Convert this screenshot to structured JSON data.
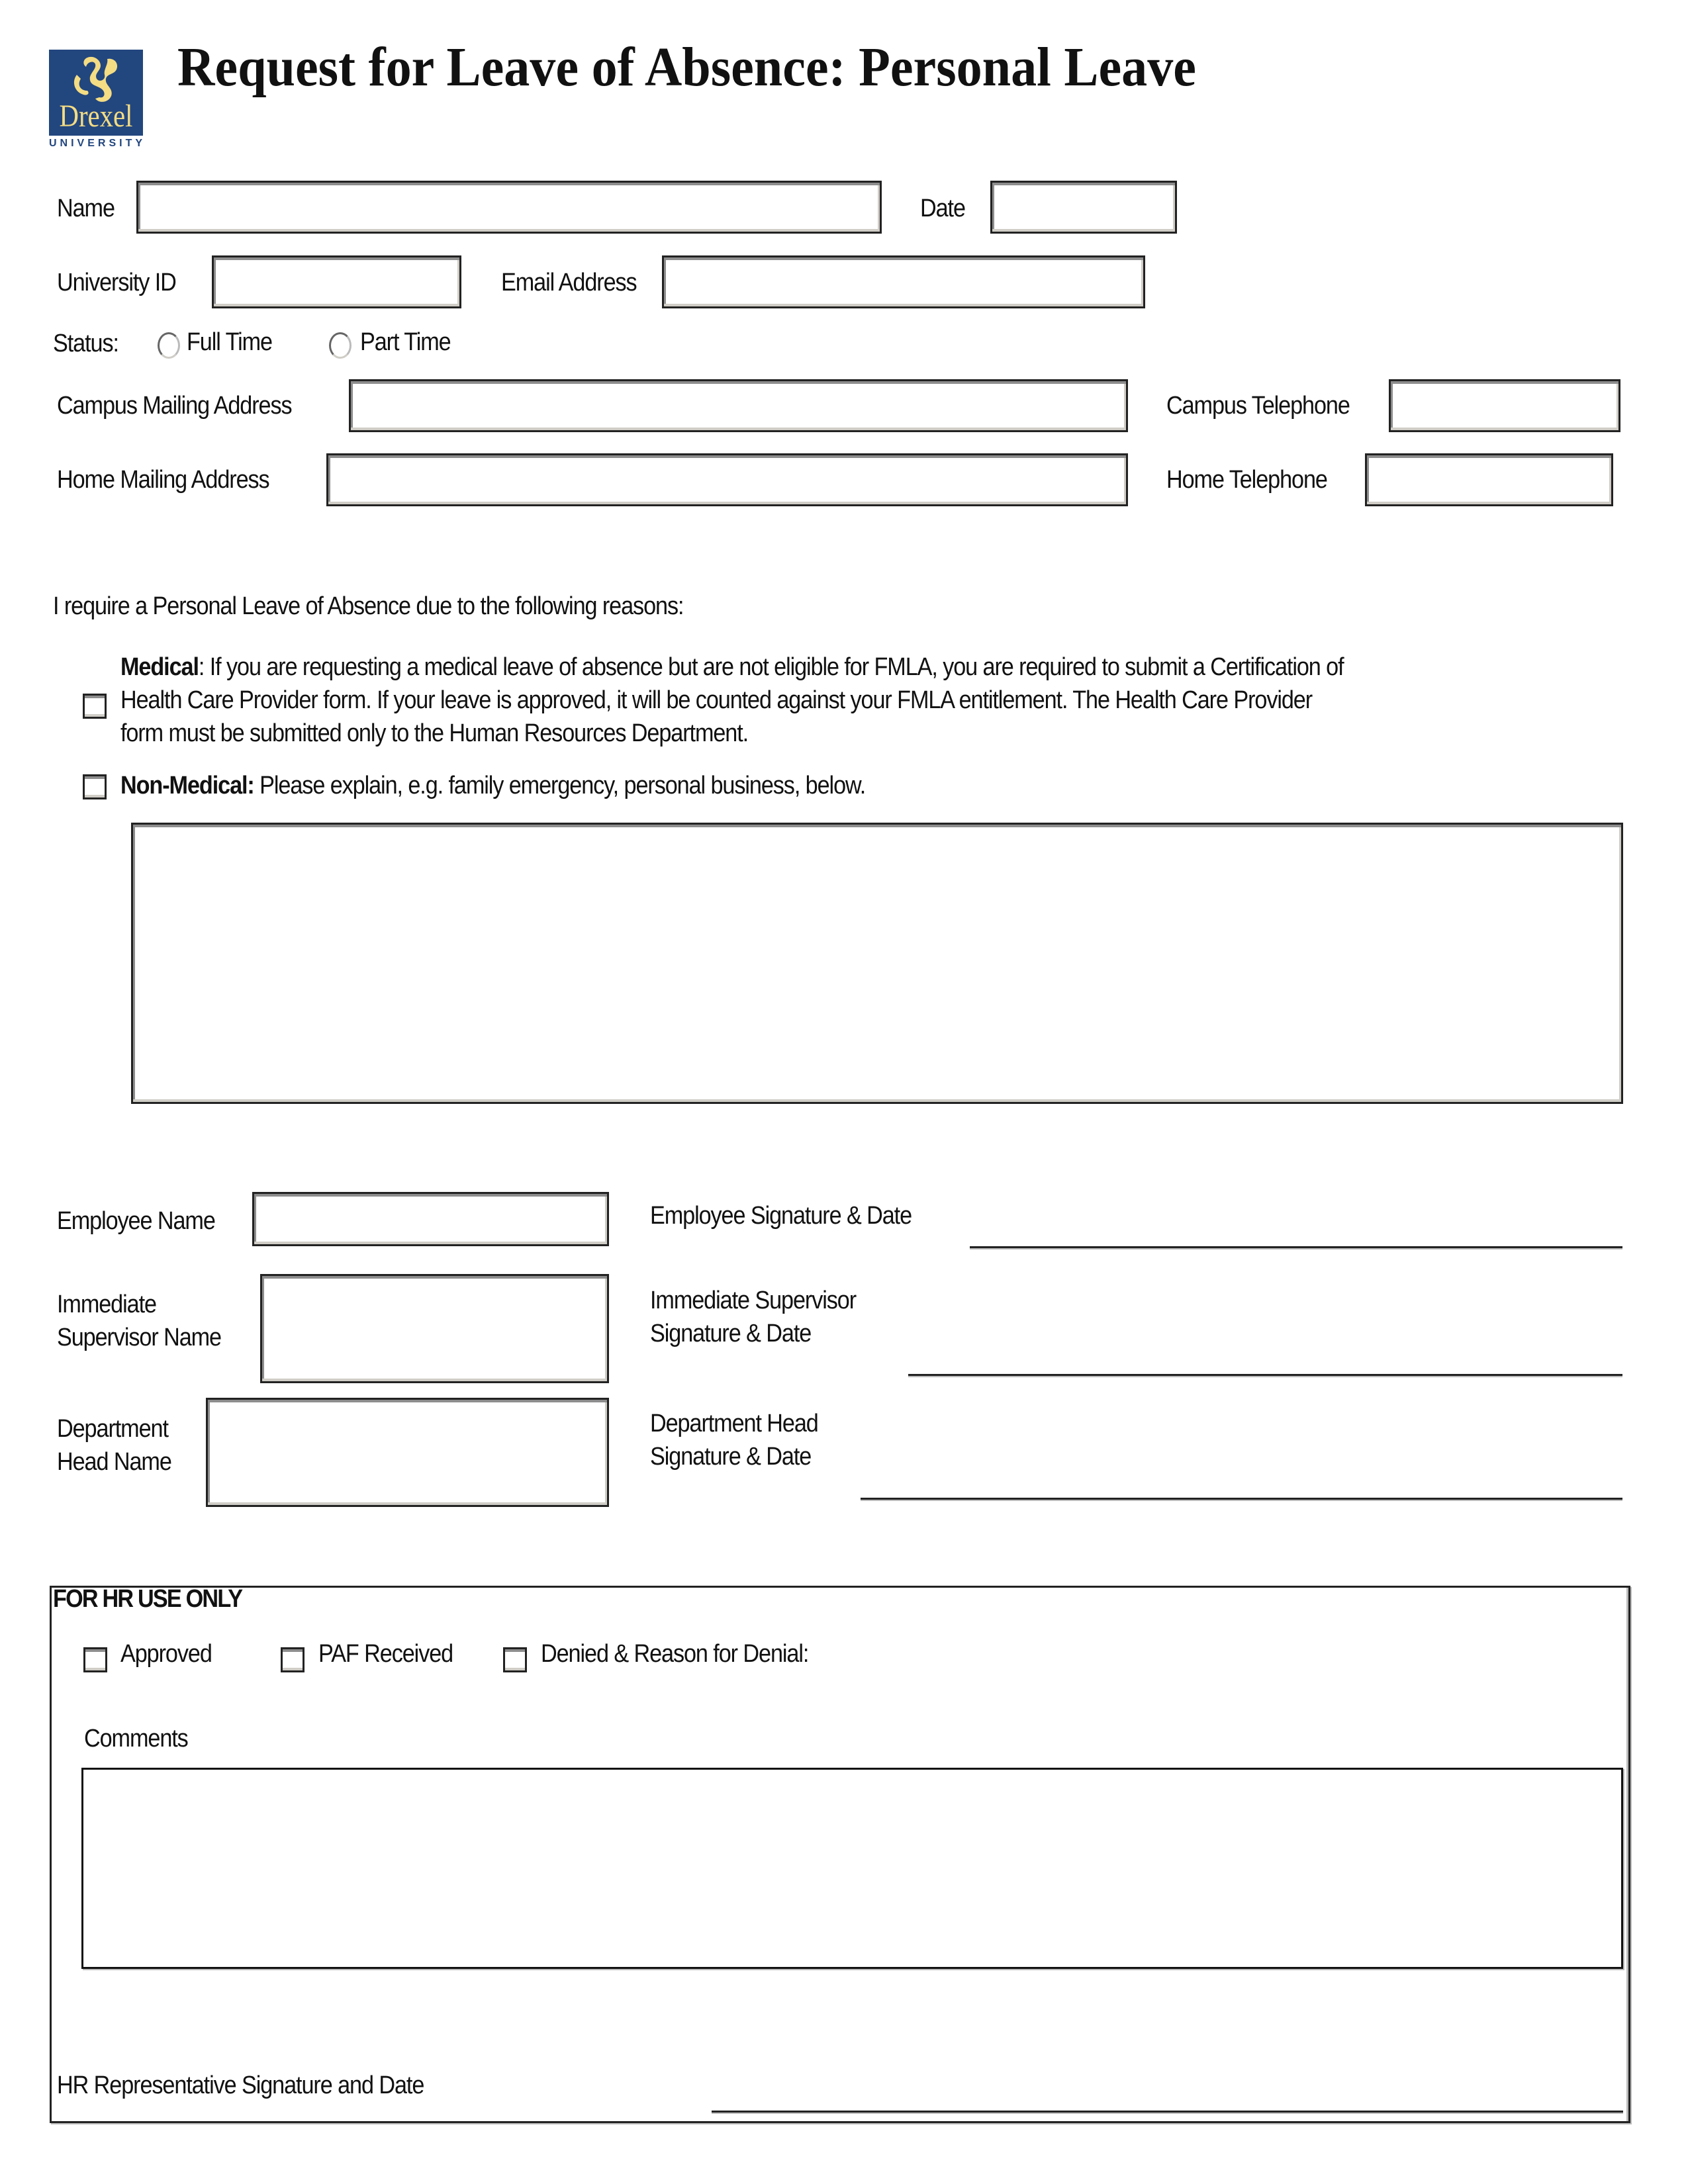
{
  "header": {
    "title": "Request for Leave of Absence: Personal Leave",
    "logo": {
      "name": "drexel-dragon-logo",
      "wordmark": "Drexel",
      "subtitle": "UNIVERSITY",
      "brand_color": "#22467e",
      "accent_color": "#f3dc83"
    }
  },
  "personal_info": {
    "name": {
      "label": "Name",
      "value": ""
    },
    "date": {
      "label": "Date",
      "value": ""
    },
    "university_id": {
      "label": "University ID",
      "value": ""
    },
    "email": {
      "label": "Email Address",
      "value": ""
    },
    "status": {
      "label": "Status:",
      "options": [
        {
          "label": "Full Time",
          "selected": false
        },
        {
          "label": "Part Time",
          "selected": false
        }
      ]
    },
    "campus_address": {
      "label": "Campus Mailing Address",
      "value": ""
    },
    "campus_phone": {
      "label": "Campus Telephone",
      "value": ""
    },
    "home_address": {
      "label": "Home Mailing Address",
      "value": ""
    },
    "home_phone": {
      "label": "Home Telephone",
      "value": ""
    }
  },
  "reasons": {
    "intro": "I require a Personal Leave of Absence due to the following reasons:",
    "medical": {
      "checked": false,
      "title": "Medical",
      "lines": [
        ": If you are requesting a medical leave of absence but are not eligible for FMLA, you are required to submit a Certification of",
        "Health Care Provider form. If your leave is approved, it will be counted against your FMLA entitlement. The Health Care Provider",
        "form must be submitted only to the Human Resources Department."
      ]
    },
    "non_medical": {
      "checked": false,
      "title": "Non-Medical:",
      "text": " Please explain, e.g. family emergency, personal business, below."
    },
    "explanation_value": ""
  },
  "signatures": {
    "employee_name": {
      "label": "Employee Name",
      "value": ""
    },
    "supervisor_name": {
      "label_line1": "Immediate",
      "label_line2": "Supervisor Name",
      "value": ""
    },
    "dept_head_name": {
      "label_line1": "Department",
      "label_line2": "Head Name",
      "value": ""
    },
    "employee_sig": {
      "label": "Employee Signature & Date"
    },
    "supervisor_sig": {
      "label_line1": "Immediate Supervisor",
      "label_line2": "Signature & Date"
    },
    "dept_head_sig": {
      "label_line1": "Department Head",
      "label_line2": "Signature & Date"
    }
  },
  "hr": {
    "title": "FOR HR USE ONLY",
    "checkboxes": [
      {
        "label": "Approved",
        "checked": false
      },
      {
        "label": "PAF Received",
        "checked": false
      },
      {
        "label": "Denied & Reason for Denial:",
        "checked": false
      }
    ],
    "comments_label": "Comments",
    "comments_value": "",
    "rep_sig_label": "HR Representative Signature and Date"
  }
}
